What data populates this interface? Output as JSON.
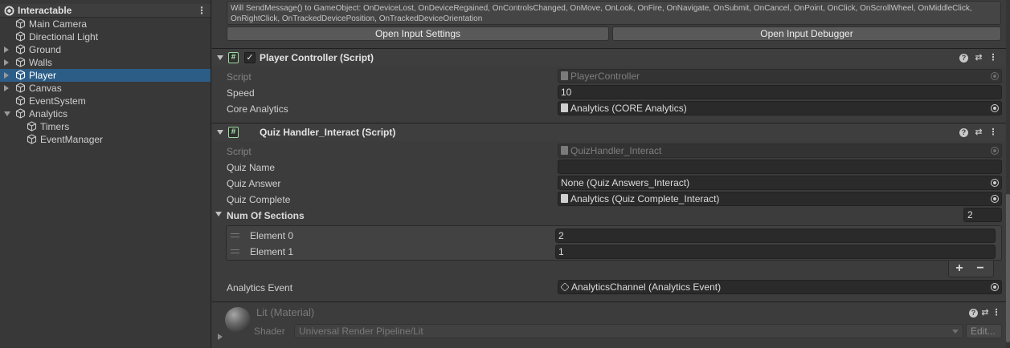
{
  "hierarchy": {
    "scene_name": "Interactable",
    "menu_glyph": "⋮",
    "items": [
      {
        "label": "Main Camera",
        "expandable": false,
        "expanded": false,
        "depth": 1
      },
      {
        "label": "Directional Light",
        "expandable": false,
        "expanded": false,
        "depth": 1
      },
      {
        "label": "Ground",
        "expandable": true,
        "expanded": false,
        "depth": 1
      },
      {
        "label": "Walls",
        "expandable": true,
        "expanded": false,
        "depth": 1
      },
      {
        "label": "Player",
        "expandable": true,
        "expanded": false,
        "depth": 1,
        "selected": true
      },
      {
        "label": "Canvas",
        "expandable": true,
        "expanded": false,
        "depth": 1
      },
      {
        "label": "EventSystem",
        "expandable": false,
        "expanded": false,
        "depth": 1
      },
      {
        "label": "Analytics",
        "expandable": true,
        "expanded": true,
        "depth": 1
      },
      {
        "label": "Timers",
        "expandable": false,
        "expanded": false,
        "depth": 2
      },
      {
        "label": "EventManager",
        "expandable": false,
        "expanded": false,
        "depth": 2
      }
    ]
  },
  "player_input": {
    "message": "Will SendMessage() to GameObject: OnDeviceLost, OnDeviceRegained, OnControlsChanged, OnMove, OnLook, OnFire, OnNavigate, OnSubmit, OnCancel, OnPoint, OnClick, OnScrollWheel, OnMiddleClick, OnRightClick, OnTrackedDevicePosition, OnTrackedDeviceOrientation",
    "open_settings_label": "Open Input Settings",
    "open_debugger_label": "Open Input Debugger"
  },
  "player_controller": {
    "script_glyph": "#",
    "check_glyph": "✓",
    "title": "Player Controller (Script)",
    "script_label": "Script",
    "script_value": "PlayerController",
    "speed_label": "Speed",
    "speed_value": "10",
    "core_analytics_label": "Core Analytics",
    "core_analytics_value": "Analytics (CORE Analytics)"
  },
  "quiz_handler": {
    "script_glyph": "#",
    "title": "Quiz Handler_Interact (Script)",
    "script_label": "Script",
    "script_value": "QuizHandler_Interact",
    "quiz_name_label": "Quiz Name",
    "quiz_name_value": "",
    "quiz_answer_label": "Quiz Answer",
    "quiz_answer_value": "None (Quiz Answers_Interact)",
    "quiz_complete_label": "Quiz Complete",
    "quiz_complete_value": "Analytics (Quiz Complete_Interact)",
    "sections_label": "Num Of Sections",
    "sections_count": "2",
    "elements": [
      {
        "label": "Element 0",
        "value": "2"
      },
      {
        "label": "Element 1",
        "value": "1"
      }
    ],
    "add_glyph": "+",
    "remove_glyph": "−",
    "analytics_event_label": "Analytics Event",
    "analytics_event_value": "AnalyticsChannel (Analytics Event)"
  },
  "header_icons": {
    "help": "?",
    "presets": "⇄",
    "menu": "⋮"
  },
  "material": {
    "title": "Lit (Material)",
    "shader_label": "Shader",
    "shader_value": "Universal Render Pipeline/Lit",
    "edit_label": "Edit..."
  }
}
